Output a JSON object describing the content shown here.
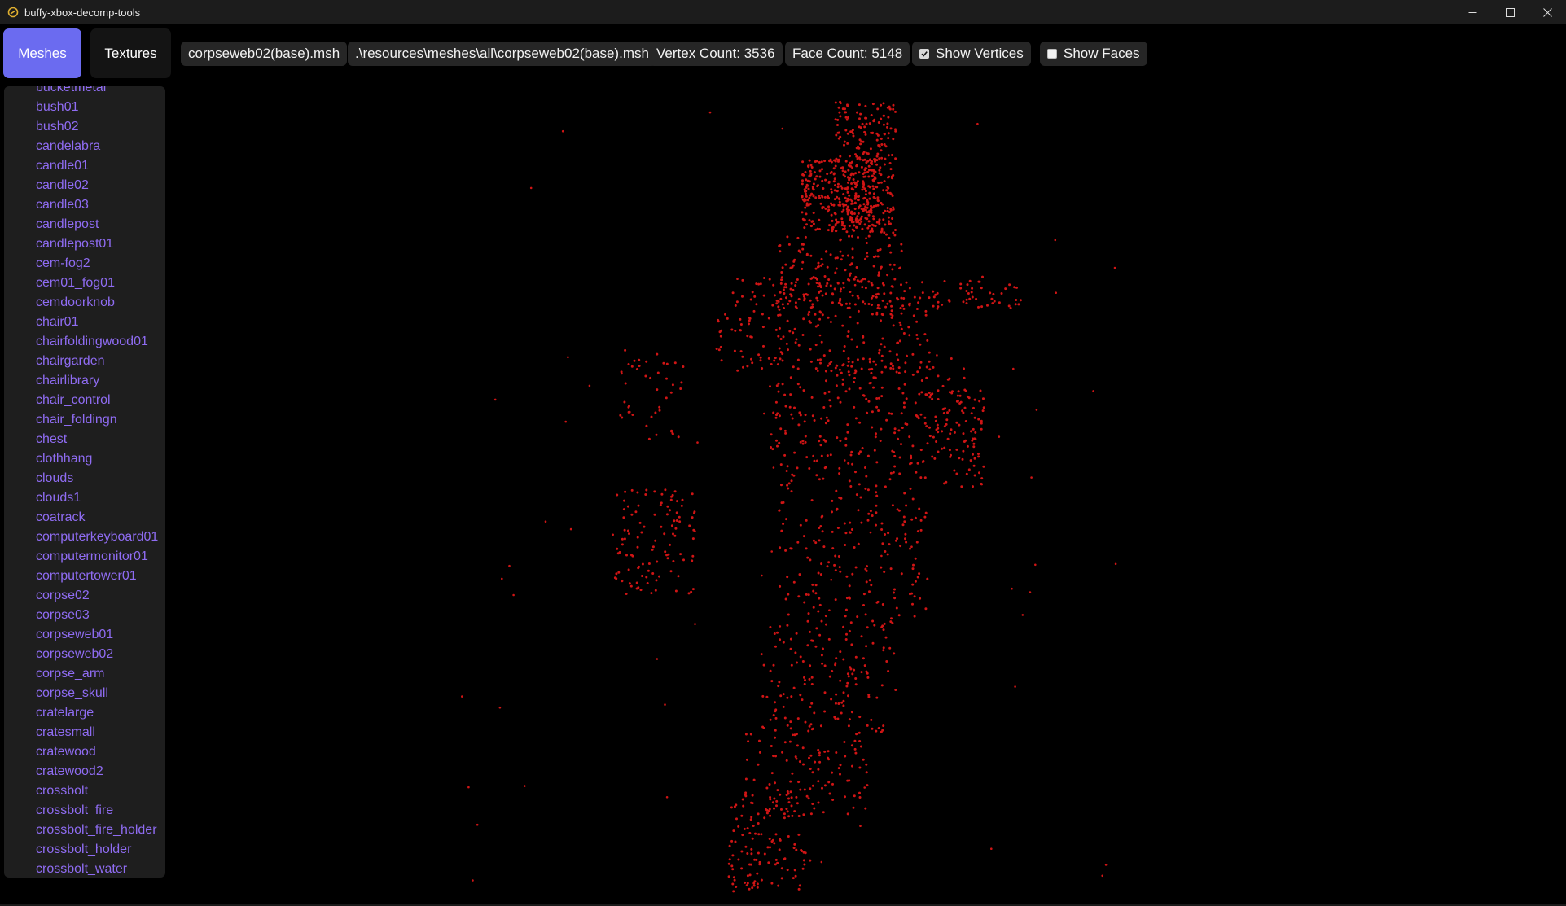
{
  "window": {
    "title": "buffy-xbox-decomp-tools"
  },
  "toolbar": {
    "tabs": {
      "meshes": "Meshes",
      "textures": "Textures"
    },
    "file_name": "corpseweb02(base).msh",
    "file_path": ".\\resources\\meshes\\all\\corpseweb02(base).msh",
    "vertex_count": "Vertex Count: 3536",
    "face_count": "Face Count: 5148",
    "show_vertices": {
      "label": "Show Vertices",
      "checked": true
    },
    "show_faces": {
      "label": "Show Faces",
      "checked": false
    }
  },
  "sidebar": {
    "items": [
      "bucketmetal",
      "bush01",
      "bush02",
      "candelabra",
      "candle01",
      "candle02",
      "candle03",
      "candlepost",
      "candlepost01",
      "cem-fog2",
      "cem01_fog01",
      "cemdoorknob",
      "chair01",
      "chairfoldingwood01",
      "chairgarden",
      "chairlibrary",
      "chair_control",
      "chair_foldingn",
      "chest",
      "clothhang",
      "clouds",
      "clouds1",
      "coatrack",
      "computerkeyboard01",
      "computermonitor01",
      "computertower01",
      "corpse02",
      "corpse03",
      "corpseweb01",
      "corpseweb02",
      "corpse_arm",
      "corpse_skull",
      "cratelarge",
      "cratesmall",
      "cratewood",
      "cratewood2",
      "crossbolt",
      "crossbolt_fire",
      "crossbolt_fire_holder",
      "crossbolt_holder",
      "crossbolt_water"
    ]
  },
  "viewport": {
    "vertex_color": "#d01515"
  },
  "colors": {
    "accent": "#6b6bf0",
    "link": "#8f6cf2",
    "background": "#000000"
  }
}
